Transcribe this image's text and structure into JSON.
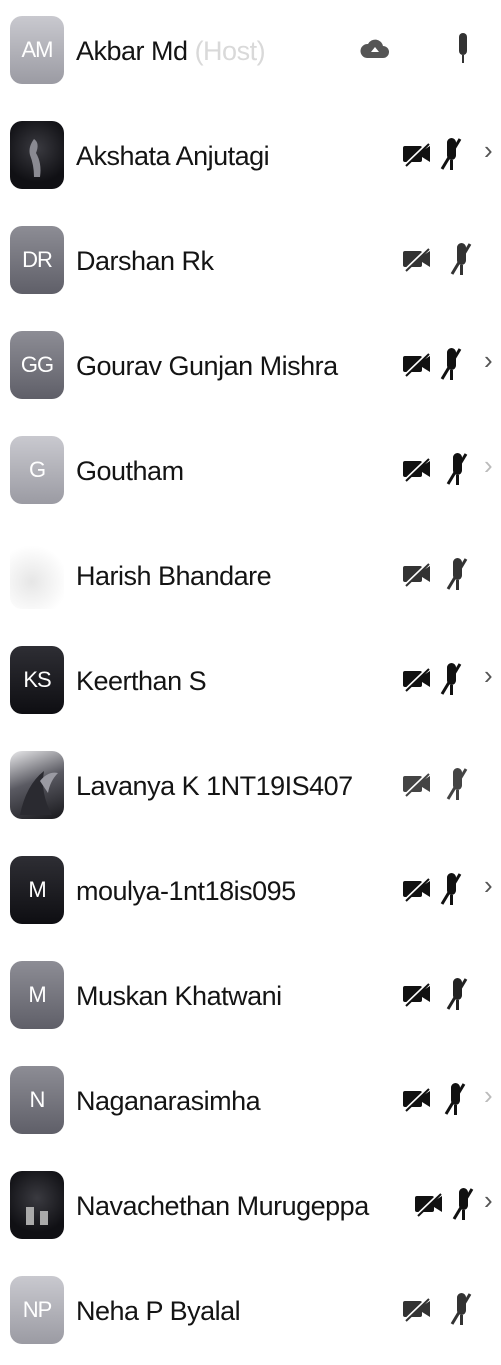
{
  "participants": [
    {
      "name": "Akbar Md",
      "suffix": "(Host)",
      "initials": "AM",
      "avatar": "light",
      "cam_icon": "cloud-icon",
      "mic_icon": "mic-icon",
      "chevron": ""
    },
    {
      "name": "Akshata Anjutagi",
      "initials": "",
      "avatar": "photo-dark",
      "cam_icon": "video-off-icon",
      "mic_icon": "mic-off-icon",
      "chevron": "›"
    },
    {
      "name": "Darshan Rk",
      "initials": "DR",
      "avatar": "mid",
      "cam_icon": "video-off-icon",
      "mic_icon": "mic-off-icon",
      "chevron": ""
    },
    {
      "name": "Gourav Gunjan Mishra",
      "initials": "GG",
      "avatar": "mid",
      "cam_icon": "video-off-icon",
      "mic_icon": "mic-off-icon",
      "chevron": "›"
    },
    {
      "name": "Goutham",
      "initials": "G",
      "avatar": "light",
      "cam_icon": "video-off-icon",
      "mic_icon": "mic-off-icon",
      "chevron": "›"
    },
    {
      "name": "Harish Bhandare",
      "initials": "",
      "avatar": "photo-pale",
      "cam_icon": "video-off-icon",
      "mic_icon": "mic-off-icon",
      "chevron": ""
    },
    {
      "name": "Keerthan S",
      "initials": "KS",
      "avatar": "dark",
      "cam_icon": "video-off-icon",
      "mic_icon": "mic-off-icon",
      "chevron": "›"
    },
    {
      "name": "Lavanya K 1NT19IS407",
      "initials": "",
      "avatar": "photo-leaf",
      "cam_icon": "video-off-icon",
      "mic_icon": "mic-off-icon",
      "chevron": ""
    },
    {
      "name": "moulya-1nt18is095",
      "initials": "M",
      "avatar": "dark",
      "cam_icon": "video-off-icon",
      "mic_icon": "mic-off-icon",
      "chevron": "›"
    },
    {
      "name": "Muskan Khatwani",
      "initials": "M",
      "avatar": "mid",
      "cam_icon": "video-off-icon",
      "mic_icon": "mic-off-icon",
      "chevron": ""
    },
    {
      "name": "Naganarasimha",
      "initials": "N",
      "avatar": "mid",
      "cam_icon": "video-off-icon",
      "mic_icon": "mic-off-icon",
      "chevron": "›"
    },
    {
      "name": "Navachethan Murugeppa",
      "initials": "",
      "avatar": "photo-dark",
      "cam_icon": "video-off-icon",
      "mic_icon": "mic-off-icon",
      "chevron": "›"
    },
    {
      "name": "Neha P Byalal",
      "initials": "NP",
      "avatar": "light",
      "cam_icon": "video-off-icon",
      "mic_icon": "mic-off-icon",
      "chevron": ""
    }
  ]
}
